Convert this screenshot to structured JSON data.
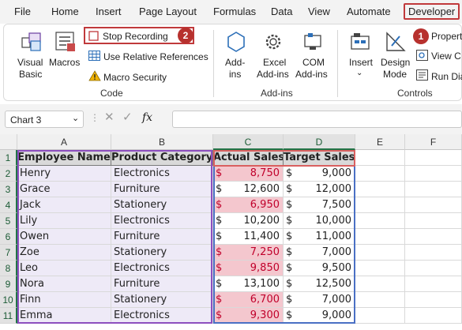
{
  "menu": {
    "tabs": [
      "File",
      "Home",
      "Insert",
      "Page Layout",
      "Formulas",
      "Data",
      "View",
      "Automate",
      "Developer"
    ]
  },
  "ribbon": {
    "code": {
      "visual_basic": [
        "Visual",
        "Basic"
      ],
      "macros": "Macros",
      "stop_recording": "Stop Recording",
      "relative_refs": "Use Relative References",
      "macro_security": "Macro Security",
      "group_label": "Code"
    },
    "addins": {
      "addins": [
        "Add-",
        "ins"
      ],
      "excel_addins": [
        "Excel",
        "Add-ins"
      ],
      "com_addins": [
        "COM",
        "Add-ins"
      ],
      "group_label": "Add-ins"
    },
    "controls": {
      "insert": "Insert",
      "design_mode": [
        "Design",
        "Mode"
      ],
      "properties": "Propert",
      "view_code": "View C",
      "run_dialog": "Run Dia",
      "group_label": "Controls"
    }
  },
  "badges": {
    "developer": "1",
    "stop_recording": "2"
  },
  "formula_bar": {
    "name_box": "Chart 3",
    "fx": "fx",
    "formula": ""
  },
  "columns": [
    "A",
    "B",
    "C",
    "D",
    "E",
    "F"
  ],
  "rows": [
    "1",
    "2",
    "3",
    "4",
    "5",
    "6",
    "7",
    "8",
    "9",
    "10",
    "11"
  ],
  "table": {
    "headers": [
      "Employee Name",
      "Product Category",
      "Actual Sales",
      "Target Sales"
    ],
    "currency": "$",
    "rows": [
      {
        "name": "Henry",
        "category": "Electronics",
        "actual": "8,750",
        "target": "9,000",
        "below": true
      },
      {
        "name": "Grace",
        "category": "Furniture",
        "actual": "12,600",
        "target": "12,000",
        "below": false
      },
      {
        "name": "Jack",
        "category": "Stationery",
        "actual": "6,950",
        "target": "7,500",
        "below": true
      },
      {
        "name": "Lily",
        "category": "Electronics",
        "actual": "10,200",
        "target": "10,000",
        "below": false
      },
      {
        "name": "Owen",
        "category": "Furniture",
        "actual": "11,400",
        "target": "11,000",
        "below": false
      },
      {
        "name": "Zoe",
        "category": "Stationery",
        "actual": "7,250",
        "target": "7,000",
        "below": true
      },
      {
        "name": "Leo",
        "category": "Electronics",
        "actual": "9,850",
        "target": "9,500",
        "below": true
      },
      {
        "name": "Nora",
        "category": "Furniture",
        "actual": "13,100",
        "target": "12,500",
        "below": false
      },
      {
        "name": "Finn",
        "category": "Stationery",
        "actual": "6,700",
        "target": "7,000",
        "below": true
      },
      {
        "name": "Emma",
        "category": "Electronics",
        "actual": "9,300",
        "target": "9,000",
        "below": true
      }
    ]
  },
  "colors": {
    "highlight_fill": "#f4c7ce",
    "highlight_text": "#c0002b",
    "annotation_red": "#c0393b",
    "excel_green": "#217346"
  }
}
